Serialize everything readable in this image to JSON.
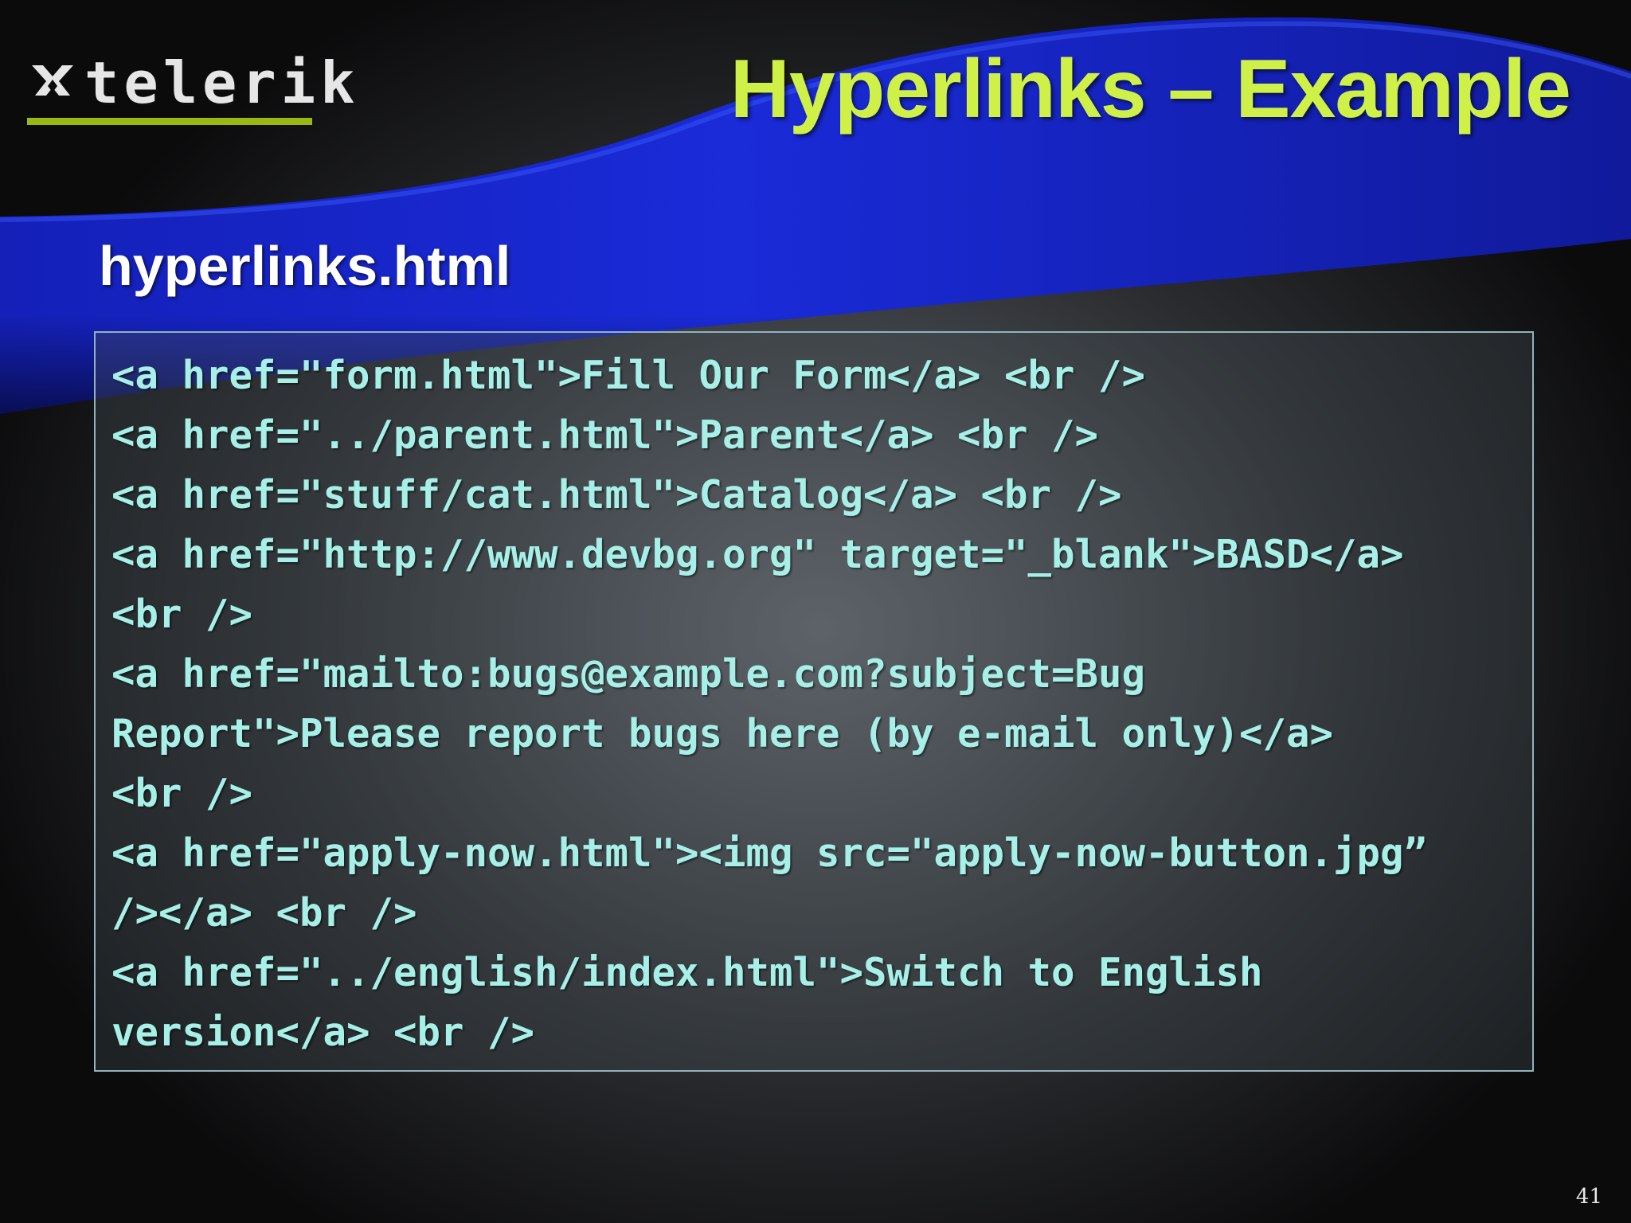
{
  "logo": {
    "text": "telerik",
    "mark_icon": "telerik-cross-mark-icon",
    "accent_color": "#9ab814"
  },
  "slide": {
    "title": "Hyperlinks – Example",
    "subtitle": "hyperlinks.html",
    "page_number": "41",
    "title_color": "#cff046",
    "code_color": "#a6f0e8",
    "swoosh_color": "#1a2bd8"
  },
  "code": {
    "lines": [
      "<a href=\"form.html\">Fill Our Form</a> <br />",
      "<a href=\"../parent.html\">Parent</a> <br />",
      "<a href=\"stuff/cat.html\">Catalog</a> <br />",
      "<a href=\"http://www.devbg.org\" target=\"_blank\">BASD</a>",
      "<br />",
      "<a href=\"mailto:bugs@example.com?subject=Bug",
      "Report\">Please report bugs here (by e-mail only)</a>",
      "<br />",
      "<a href=\"apply-now.html\"><img src=\"apply-now-button.jpg”",
      "/></a> <br />",
      "<a href=\"../english/index.html\">Switch to English",
      "version</a> <br />"
    ]
  }
}
